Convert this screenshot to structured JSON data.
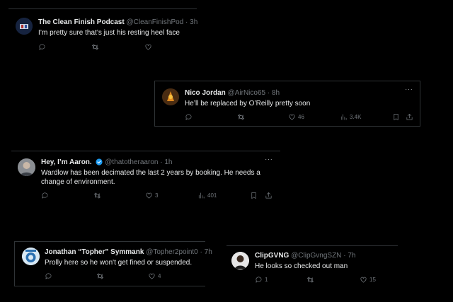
{
  "tweets": [
    {
      "name": "The Clean Finish Podcast",
      "handle": "@CleanFinishPod",
      "time": "3h",
      "text": "I’m pretty sure that’s just his resting heel face"
    },
    {
      "name": "Nico Jordan",
      "handle": "@AirNico65",
      "time": "8h",
      "text": "He’ll be replaced by O’Reilly pretty soon",
      "likes": "46",
      "views": "3.4K"
    },
    {
      "name": "Hey, I’m Aaron.",
      "handle": "@thatotheraaron",
      "time": "1h",
      "text_line1": "Wardlow has been decimated the last 2 years by booking.  He needs a",
      "text_line2": "change of environment.",
      "likes": "3",
      "views": "401"
    },
    {
      "name": "Jonathan “Topher” Symmank",
      "handle": "@Topher2point0",
      "time": "7h",
      "text": "Prolly here so he won't get fined or suspended.",
      "likes": "4"
    },
    {
      "name": "ClipGVNG",
      "handle": "@ClipGvngSZN",
      "time": "7h",
      "text": "He looks so checked out man",
      "replies": "1",
      "likes": "15"
    }
  ],
  "icons": {
    "reply": "reply-icon",
    "retweet": "retweet-icon",
    "like": "like-icon",
    "views": "views-icon",
    "bookmark": "bookmark-icon",
    "share": "share-icon",
    "more": "more-icon",
    "verified": "verified-badge-icon"
  },
  "colors": {
    "background": "#000000",
    "text": "#e7e9ea",
    "muted": "#71767b",
    "border": "#2f3336",
    "verified": "#1d9bf0"
  }
}
